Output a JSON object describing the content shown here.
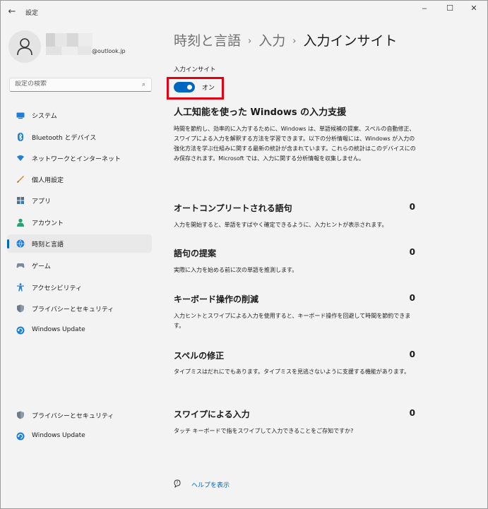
{
  "window": {
    "title": "設定",
    "back_icon": "back-arrow-icon",
    "minimize_glyph": "‒",
    "maximize_glyph": "☐",
    "close_glyph": "✕"
  },
  "profile": {
    "email_domain": "@outlook.jp"
  },
  "search": {
    "placeholder": "設定の検索",
    "icon": "search-icon"
  },
  "sidebar": {
    "items": [
      {
        "label": "システム",
        "icon": "system-icon",
        "active": false
      },
      {
        "label": "Bluetooth とデバイス",
        "icon": "bluetooth-icon",
        "active": false
      },
      {
        "label": "ネットワークとインターネット",
        "icon": "network-icon",
        "active": false
      },
      {
        "label": "個人用設定",
        "icon": "personalization-icon",
        "active": false
      },
      {
        "label": "アプリ",
        "icon": "apps-icon",
        "active": false
      },
      {
        "label": "アカウント",
        "icon": "account-icon",
        "active": false
      },
      {
        "label": "時刻と言語",
        "icon": "time-language-icon",
        "active": true
      },
      {
        "label": "ゲーム",
        "icon": "gaming-icon",
        "active": false
      },
      {
        "label": "アクセシビリティ",
        "icon": "accessibility-icon",
        "active": false
      },
      {
        "label": "プライバシーとセキュリティ",
        "icon": "privacy-shield-icon",
        "active": false
      },
      {
        "label": "Windows Update",
        "icon": "windows-update-icon",
        "active": false
      }
    ],
    "bottom_items": [
      {
        "label": "プライバシーとセキュリティ",
        "icon": "privacy-shield-icon"
      },
      {
        "label": "Windows Update",
        "icon": "windows-update-icon"
      }
    ]
  },
  "breadcrumb": {
    "part1": "時刻と言語",
    "part2": "入力",
    "current": "入力インサイト",
    "separator": "›"
  },
  "insights": {
    "section_label": "入力インサイト",
    "toggle_state": "オン",
    "toggle_on": true,
    "heading": "人工知能を使った Windows の入力支援",
    "description": "時間を節約し、効率的に入力するために、Windows は、単語候補の提案、スペルの自動修正、スワイプによる入力を解釈する方法を学習できます。以下の分析情報には、Windows が入力の強化方法を学ぶ仕組みに関する最新の統計が含まれています。これらの統計はこのデバイスにのみ保存されます。Microsoft では、入力に関する分析情報を収集しません。"
  },
  "stats": [
    {
      "title": "オートコンプリートされる語句",
      "value": "0",
      "description": "入力を開始すると、単語をすばやく確定できるように、入力ヒントが表示されます。"
    },
    {
      "title": "語句の提案",
      "value": "0",
      "description": "実際に入力を始める前に次の単語を推測します。"
    },
    {
      "title": "キーボード操作の削減",
      "value": "0",
      "description": "入力ヒントとスワイプによる入力を使用すると、キーボード操作を回避して時間を節約できます。"
    },
    {
      "title": "スペルの修正",
      "value": "0",
      "description": "タイプミスはだれにでもあります。タイプミスを見逃さないように支援する機能があります。"
    },
    {
      "title": "スワイプによる入力",
      "value": "0",
      "description": "タッチ キーボードで指をスワイプして入力できることをご存知ですか?"
    }
  ],
  "help": {
    "label": "ヘルプを表示",
    "icon": "help-icon"
  },
  "colors": {
    "accent": "#0067c0",
    "highlight_box": "#e50012",
    "background": "#f3f3f3"
  }
}
